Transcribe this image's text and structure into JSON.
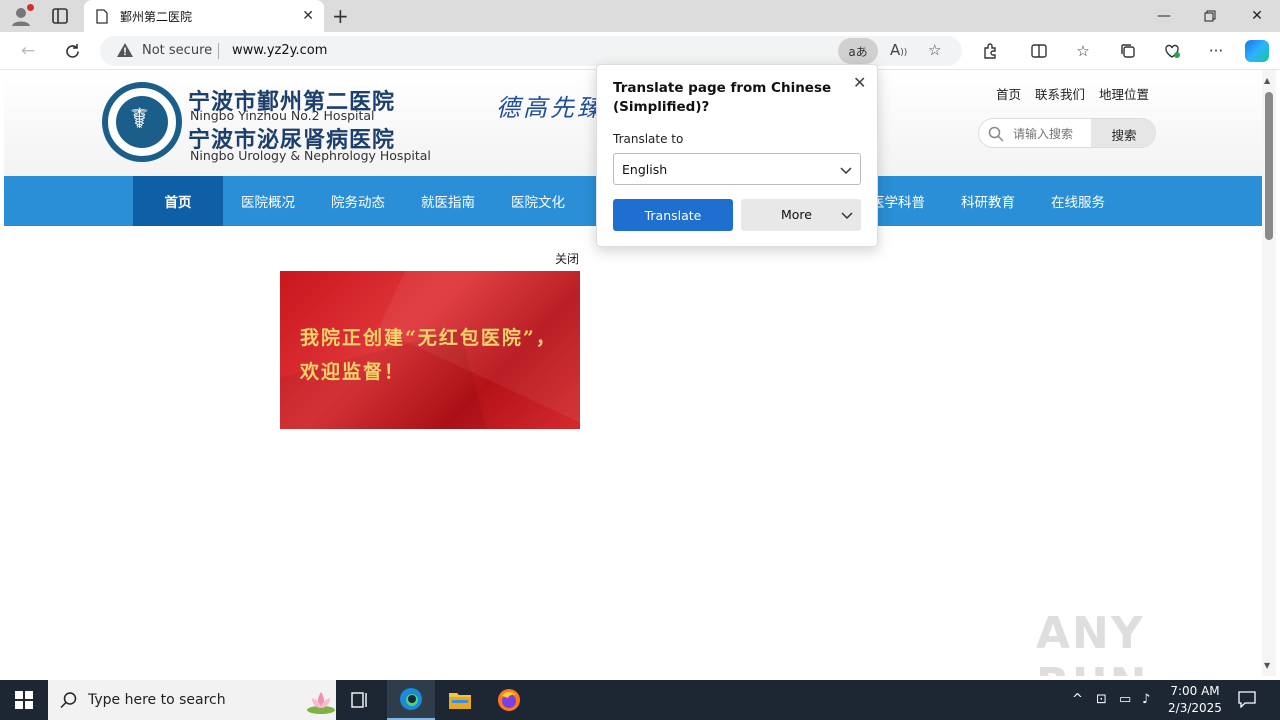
{
  "browser": {
    "tab_title": "鄞州第二医院",
    "not_secure": "Not secure",
    "url": "www.yz2y.com",
    "translate_icon_text": "aあ"
  },
  "site": {
    "hospital_name_1": "宁波市鄞州第二医院",
    "hospital_name_1_en": "Ningbo Yinzhou No.2 Hospital",
    "hospital_name_2": "宁波市泌尿肾病医院",
    "hospital_name_2_en": "Ningbo Urology & Nephrology Hospital",
    "slogan": "德高先臻",
    "top_links": [
      "首页",
      "联系我们",
      "地理位置"
    ],
    "search_placeholder": "请输入搜索",
    "search_button": "搜索",
    "nav": [
      "首页",
      "医院概况",
      "院务动态",
      "就医指南",
      "医院文化",
      "医学科普",
      "科研教育",
      "在线服务"
    ],
    "close_ad": "关闭",
    "banner_text": "我院正创建“无红包医院”，欢迎监督！"
  },
  "translate_popup": {
    "title": "Translate page from Chinese (Simplified)?",
    "label": "Translate to",
    "selected_language": "English",
    "translate_button": "Translate",
    "more_button": "More"
  },
  "taskbar": {
    "search_placeholder": "Type here to search",
    "time": "7:00 AM",
    "date": "2/3/2025"
  },
  "watermark": "ANY RUN",
  "colors": {
    "nav_blue": "#2a8fd6",
    "nav_active": "#0f5fa6",
    "translate_blue": "#1f6fd0",
    "banner_red": "#c8161d",
    "banner_text": "#f6d36b"
  }
}
